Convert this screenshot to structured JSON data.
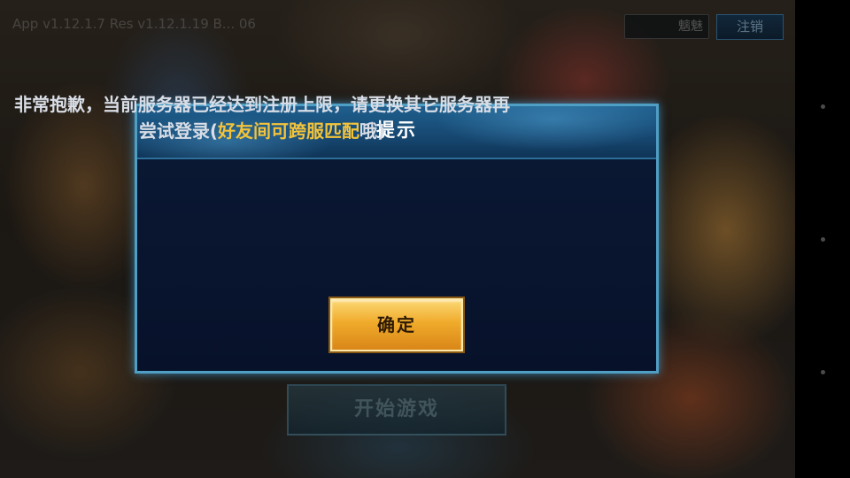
{
  "background": {
    "version_text": "App v1.12.1.7 Res v1.12.1.19 B... 06"
  },
  "top_bar": {
    "user_name": "魑魅",
    "logout_label": "注销"
  },
  "main": {
    "start_label": "开始游戏"
  },
  "dialog": {
    "title": "提示",
    "message_part1": "非常抱歉，当前服务器已经达到注册上限，请更换其它服务器再尝试登录(",
    "message_highlight": "好友间可跨服匹配",
    "message_part2": "哦)",
    "confirm_label": "确定"
  },
  "colors": {
    "dialog_border": "#4f9ec4",
    "highlight_text": "#f3c33b",
    "confirm_button": "#f0ab2b"
  }
}
